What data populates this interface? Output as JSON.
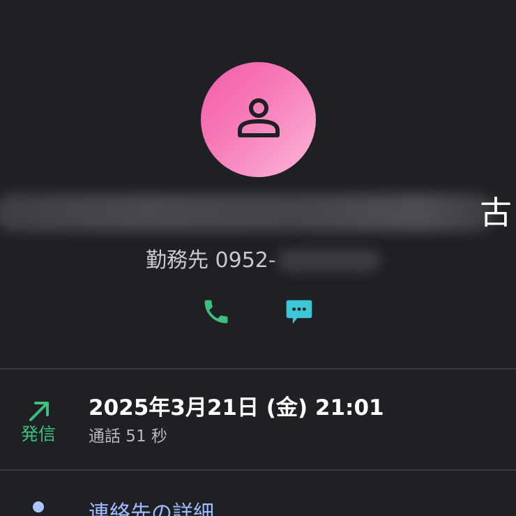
{
  "contact": {
    "avatar_icon": "person-icon",
    "avatar_color": "#f45aa6",
    "name_visible_tail": "古",
    "number_label": "勤務先 0952-"
  },
  "actions": {
    "call_icon": "phone-icon",
    "message_icon": "message-icon",
    "call_color": "#3fbf7f",
    "message_color": "#3cc6d6"
  },
  "call_entry": {
    "direction_icon": "outgoing-arrow-icon",
    "direction_label": "発信",
    "datetime": "2025年3月21日 (金) 21:01",
    "duration": "通話 51 秒"
  },
  "details": {
    "label": "連絡先の詳細"
  }
}
